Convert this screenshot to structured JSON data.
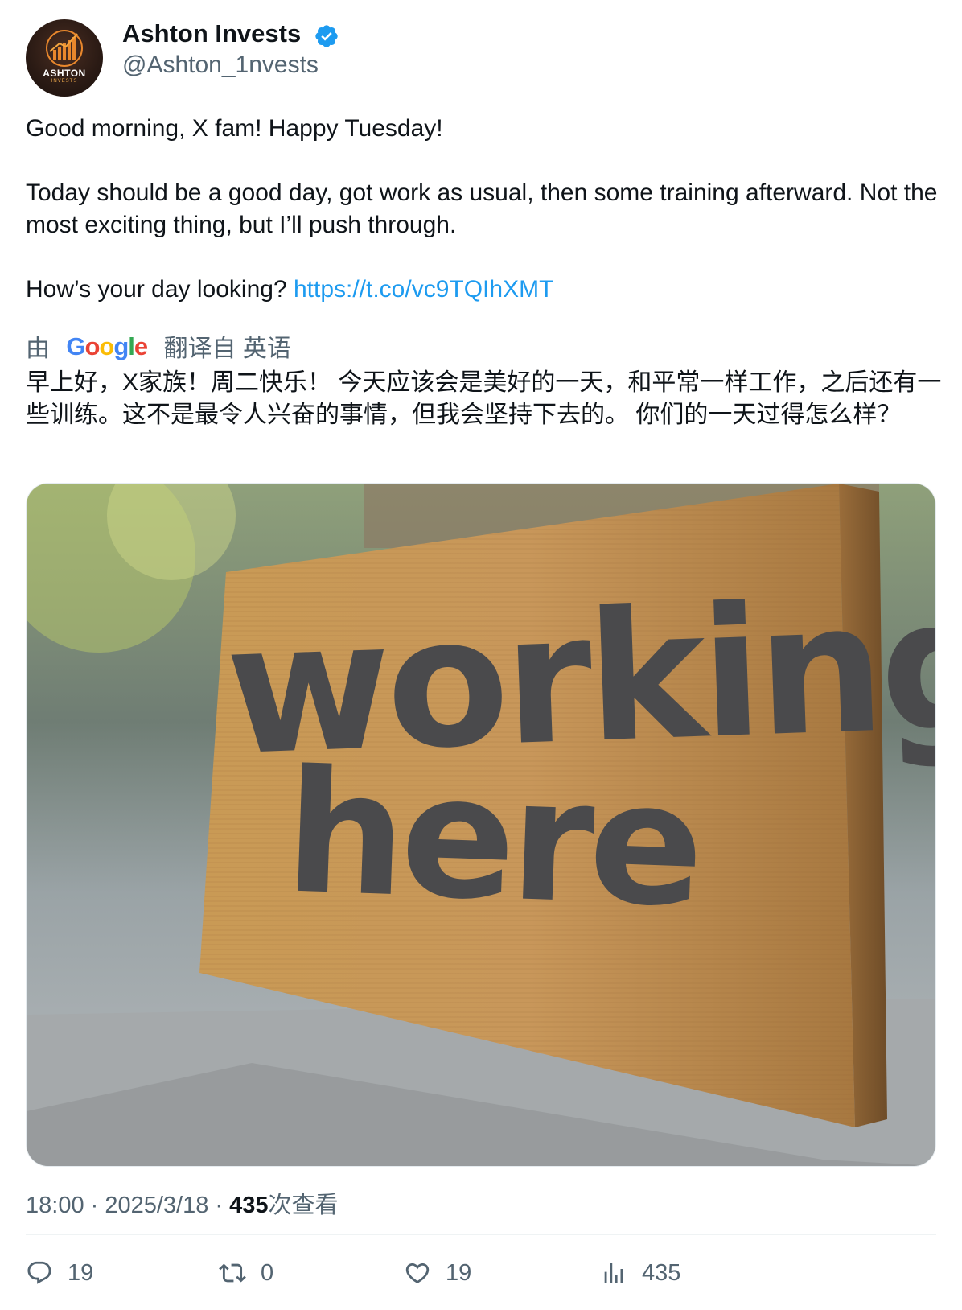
{
  "author": {
    "name": "Ashton Invests",
    "handle": "@Ashton_1nvests",
    "avatar_brand": "ASHTON",
    "avatar_sub": "INVESTS",
    "verified_color": "#1d9bf0"
  },
  "tweet": {
    "line1": "Good morning, X fam! Happy Tuesday!",
    "line2": "Today should be a good day, got work as usual, then some training afterward. Not the most exciting thing, but I’ll push through.",
    "line3": "How’s your day looking? ",
    "link": "https://t.co/vc9TQIhXMT"
  },
  "translation": {
    "prefix": "由",
    "provider": "Google",
    "suffix": "翻译自 英语",
    "text": "早上好，X家族！周二快乐！ 今天应该会是美好的一天，和平常一样工作，之后还有一些训练。这不是最令人兴奋的事情，但我会坚持下去的。 你们的一天过得怎么样？"
  },
  "media": {
    "sign_line1": "working",
    "sign_line2": "here"
  },
  "meta": {
    "time": "18:00",
    "sep": " · ",
    "date": "2025/3/18",
    "views_count": "435",
    "views_label": "次查看"
  },
  "actions": {
    "replies": "19",
    "reposts": "0",
    "likes": "19",
    "views": "435"
  },
  "colors": {
    "accent": "#1d9bf0",
    "text": "#0f1419",
    "secondary": "#536471"
  },
  "icons": [
    "reply-icon",
    "repost-icon",
    "like-icon",
    "views-icon",
    "verified-badge-icon"
  ]
}
